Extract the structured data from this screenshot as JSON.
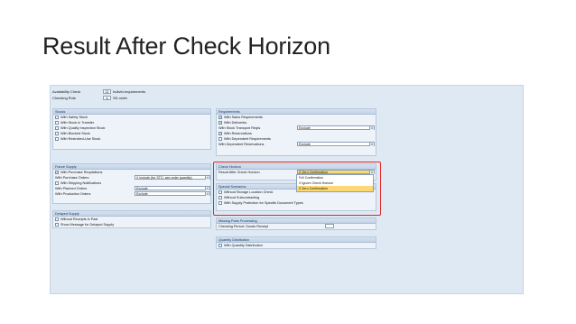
{
  "slide_title": "Result After Check Horizon",
  "header": {
    "availability_check": {
      "label": "Availability Check",
      "code": "02",
      "value": "Individ.requirements"
    },
    "checking_rule": {
      "label": "Checking Rule",
      "code": "A",
      "value": "SD order"
    }
  },
  "stocks": {
    "title": "Stocks",
    "items": [
      {
        "label": "With Safety Stock",
        "checked": false
      },
      {
        "label": "With Stock in Transfer",
        "checked": false
      },
      {
        "label": "With Quality Inspection Stock",
        "checked": false
      },
      {
        "label": "With Blocked Stock",
        "checked": false
      },
      {
        "label": "With Restricted-Use Stock",
        "checked": false
      }
    ]
  },
  "future_supply": {
    "title": "Future Supply",
    "purchase_requisitions": {
      "label": "With Purchase Requisitions",
      "checked": true
    },
    "purchase_orders": {
      "label": "With Purchase Orders",
      "value": "X Include (for STO, see order quantity)"
    },
    "shipping_notifications": {
      "label": "With Shipping Notifications",
      "checked": false
    },
    "planned_orders": {
      "label": "With Planned Orders",
      "value": "Exclude"
    },
    "production_orders": {
      "label": "With Production Orders",
      "value": "Exclude"
    }
  },
  "delayed_supply": {
    "title": "Delayed Supply",
    "items": [
      {
        "label": "Without Receipts in Past",
        "checked": false
      },
      {
        "label": "Show Message for Delayed Supply",
        "checked": false
      }
    ]
  },
  "requirements": {
    "title": "Requirements",
    "sales_requirements": {
      "label": "With Sales Requirements",
      "checked": true
    },
    "deliveries": {
      "label": "With Deliveries",
      "checked": true
    },
    "stock_transport": {
      "label": "With Stock Transport Reqts",
      "value": "Exclude"
    },
    "reservations": {
      "label": "With Reservations",
      "checked": true
    },
    "dependent_requirements": {
      "label": "With Dependent Requirements",
      "checked": false
    },
    "dependent_reservations": {
      "label": "With Dependent Reservations",
      "value": "Exclude"
    }
  },
  "check_horizon": {
    "title": "Check Horizon",
    "result_label": "Result After Check Horizon",
    "result_value": "Z Zero Confirmation",
    "options": [
      {
        "label": "Full Confirmation",
        "highlighted": false
      },
      {
        "label": "X Ignore Check Horizon",
        "highlighted": false
      },
      {
        "label": "Z Zero Confirmation",
        "highlighted": true
      }
    ]
  },
  "special_scenarios": {
    "title": "Special Scenarios",
    "items": [
      {
        "label": "Without Storage Location Check",
        "checked": false
      },
      {
        "label": "Without Subcontracting",
        "checked": false
      },
      {
        "label": "With Supply Protection for Specific Document Types",
        "checked": false
      }
    ]
  },
  "missing_parts": {
    "title": "Missing Parts Processing",
    "checking_period_label": "Checking Period: Goods Receipt"
  },
  "quantity_distribution": {
    "title": "Quantity Distribution",
    "item": {
      "label": "With Quantity Distribution",
      "checked": false
    }
  },
  "colors": {
    "highlight": "#fbd872",
    "callout": "#e02828",
    "panel_bg": "#eef3f9"
  }
}
